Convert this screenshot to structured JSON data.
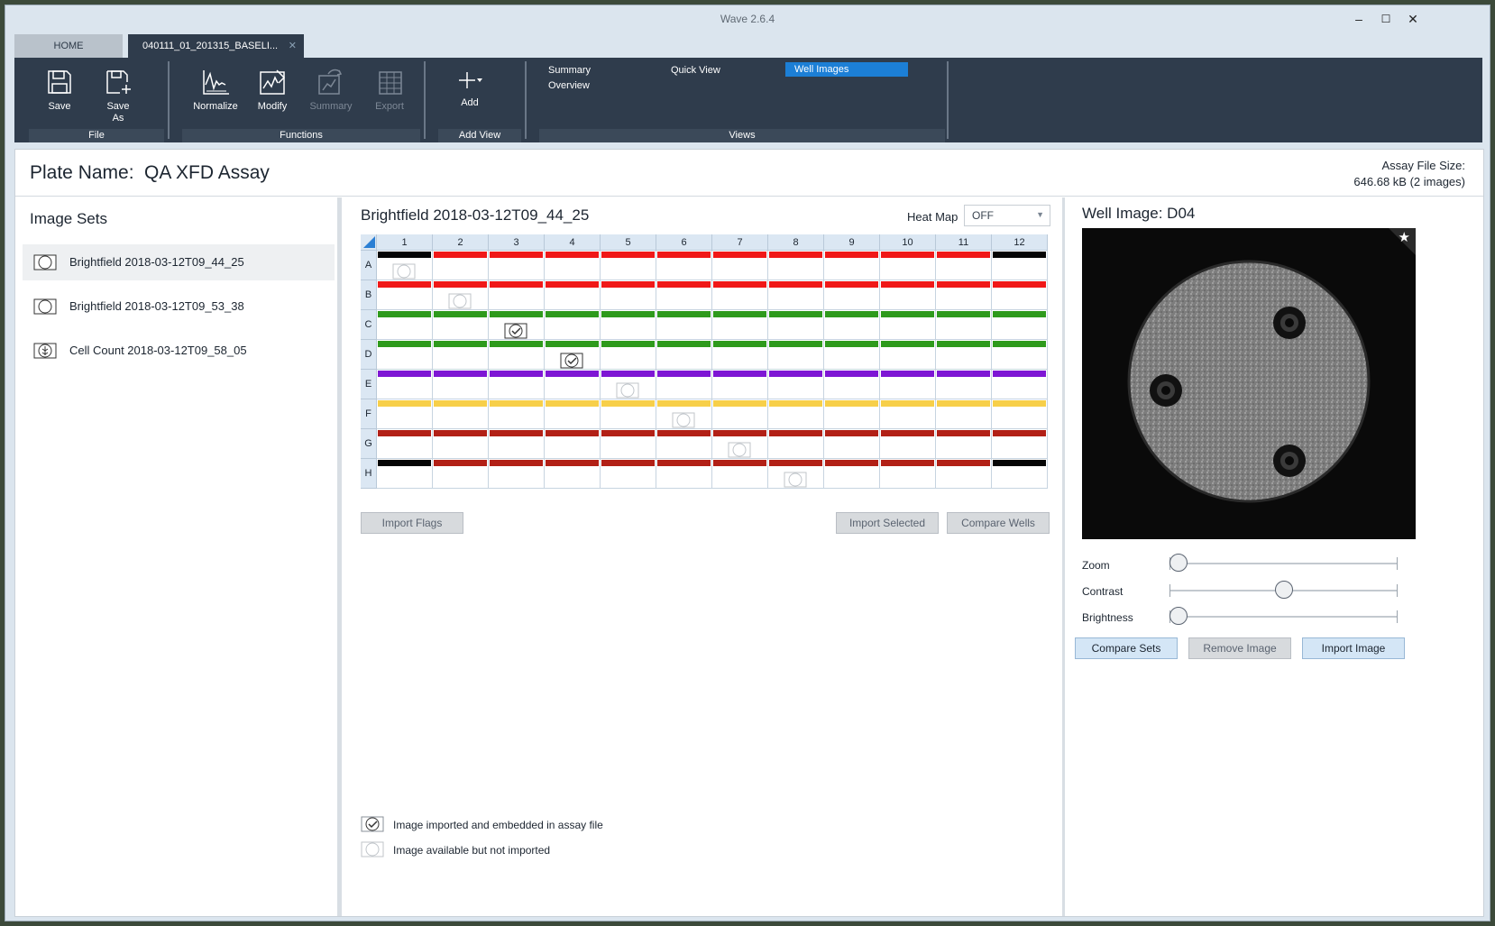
{
  "window": {
    "title": "Wave 2.6.4",
    "minimize": "–",
    "maximize": "☐",
    "close": "✕"
  },
  "tabs": {
    "home": "HOME",
    "doc": "040111_01_201315_BASELI...",
    "doc_close": "✕"
  },
  "ribbon": {
    "file": {
      "save": "Save",
      "save_as": "Save As",
      "group": "File"
    },
    "functions": {
      "normalize": "Normalize",
      "modify": "Modify",
      "summary": "Summary",
      "export": "Export",
      "group": "Functions"
    },
    "add_view": {
      "add": "Add",
      "group": "Add View"
    },
    "views": {
      "summary": "Summary",
      "overview": "Overview",
      "quick_view": "Quick View",
      "well_images": "Well Images",
      "group": "Views"
    }
  },
  "plate": {
    "label": "Plate Name:",
    "name": "QA XFD Assay",
    "size_label": "Assay File Size:",
    "size_value": "646.68 kB  (2 images)"
  },
  "image_sets": {
    "title": "Image Sets",
    "items": [
      {
        "label": "Brightfield 2018-03-12T09_44_25",
        "icon": "brightfield-icon",
        "selected": true
      },
      {
        "label": "Brightfield 2018-03-12T09_53_38",
        "icon": "brightfield-icon",
        "selected": false
      },
      {
        "label": "Cell Count 2018-03-12T09_58_05",
        "icon": "cell-count-icon",
        "selected": false
      }
    ]
  },
  "plate_map": {
    "title": "Brightfield 2018-03-12T09_44_25",
    "heat_map_label": "Heat Map",
    "heat_map_value": "OFF",
    "columns": [
      "1",
      "2",
      "3",
      "4",
      "5",
      "6",
      "7",
      "8",
      "9",
      "10",
      "11",
      "12"
    ],
    "rows": [
      "A",
      "B",
      "C",
      "D",
      "E",
      "F",
      "G",
      "H"
    ],
    "colors": {
      "black": "#050505",
      "red": "#f01818",
      "green": "#2e9a1c",
      "purple": "#7e16d4",
      "yellow": "#f7cf49",
      "darkred": "#b22016"
    },
    "row_colors": [
      [
        "black",
        "red",
        "red",
        "red",
        "red",
        "red",
        "red",
        "red",
        "red",
        "red",
        "red",
        "black"
      ],
      [
        "red",
        "red",
        "red",
        "red",
        "red",
        "red",
        "red",
        "red",
        "red",
        "red",
        "red",
        "red"
      ],
      [
        "green",
        "green",
        "green",
        "green",
        "green",
        "green",
        "green",
        "green",
        "green",
        "green",
        "green",
        "green"
      ],
      [
        "green",
        "green",
        "green",
        "green",
        "green",
        "green",
        "green",
        "green",
        "green",
        "green",
        "green",
        "green"
      ],
      [
        "purple",
        "purple",
        "purple",
        "purple",
        "purple",
        "purple",
        "purple",
        "purple",
        "purple",
        "purple",
        "purple",
        "purple"
      ],
      [
        "yellow",
        "yellow",
        "yellow",
        "yellow",
        "yellow",
        "yellow",
        "yellow",
        "yellow",
        "yellow",
        "yellow",
        "yellow",
        "yellow"
      ],
      [
        "darkred",
        "darkred",
        "darkred",
        "darkred",
        "darkred",
        "darkred",
        "darkred",
        "darkred",
        "darkred",
        "darkred",
        "darkred",
        "darkred"
      ],
      [
        "black",
        "darkred",
        "darkred",
        "darkred",
        "darkred",
        "darkred",
        "darkred",
        "darkred",
        "darkred",
        "darkred",
        "darkred",
        "black"
      ]
    ],
    "well_icons": [
      {
        "row": 0,
        "col": 0,
        "state": "available"
      },
      {
        "row": 1,
        "col": 1,
        "state": "available"
      },
      {
        "row": 2,
        "col": 2,
        "state": "imported"
      },
      {
        "row": 3,
        "col": 3,
        "state": "imported"
      },
      {
        "row": 4,
        "col": 4,
        "state": "available"
      },
      {
        "row": 5,
        "col": 5,
        "state": "available"
      },
      {
        "row": 6,
        "col": 6,
        "state": "available"
      },
      {
        "row": 7,
        "col": 7,
        "state": "available"
      }
    ],
    "buttons": {
      "import_flags": "Import Flags",
      "import_selected": "Import Selected",
      "compare_wells": "Compare Wells"
    },
    "legend": {
      "imported": "Image imported and embedded in assay file",
      "available": "Image available but not imported"
    }
  },
  "well_image": {
    "title": "Well Image: D04",
    "star": "★",
    "zoom_label": "Zoom",
    "zoom_value": 0,
    "contrast_label": "Contrast",
    "contrast_value": 0.5,
    "brightness_label": "Brightness",
    "brightness_value": 0,
    "buttons": {
      "compare_sets": "Compare Sets",
      "remove_image": "Remove Image",
      "import_image": "Import Image"
    }
  }
}
